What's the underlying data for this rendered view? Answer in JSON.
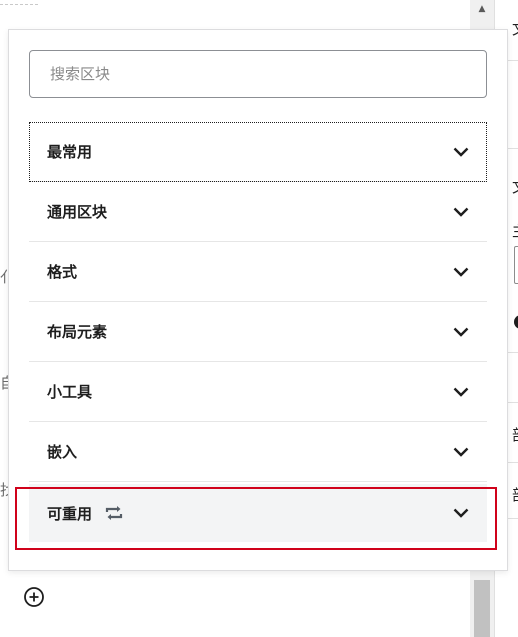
{
  "search": {
    "placeholder": "搜索区块",
    "value": ""
  },
  "panels": [
    {
      "label": "最常用",
      "expanded": false
    },
    {
      "label": "通用区块",
      "expanded": false
    },
    {
      "label": "格式",
      "expanded": false
    },
    {
      "label": "布局元素",
      "expanded": false
    },
    {
      "label": "小工具",
      "expanded": false
    },
    {
      "label": "嵌入",
      "expanded": false
    },
    {
      "label": "可重用",
      "expanded": false,
      "icon": "reusable-icon"
    }
  ],
  "background_fragments": {
    "left": [
      "亻",
      "自",
      "找"
    ],
    "right": [
      "文",
      "文",
      "主",
      "部",
      "部"
    ]
  },
  "colors": {
    "highlight": "#d0021b",
    "panel_active_bg": "#f3f4f5",
    "text": "#1e1e1e"
  },
  "icons": {
    "chevron": "chevron-down-icon",
    "add": "add-block-icon",
    "scroll_up": "scroll-up-arrow-icon"
  }
}
